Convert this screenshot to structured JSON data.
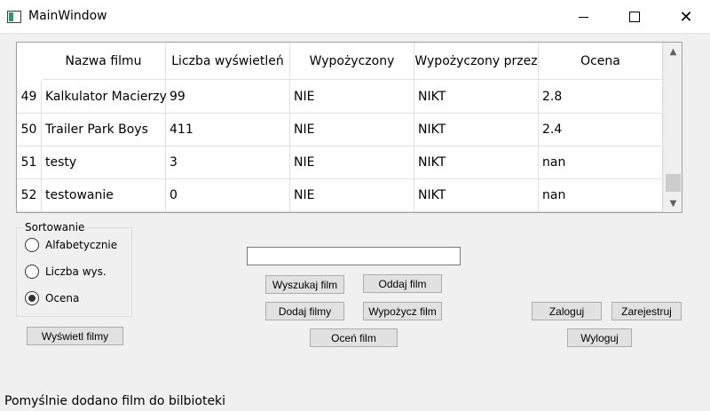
{
  "window": {
    "title": "MainWindow",
    "minimize": "",
    "maximize": "",
    "close": "✕"
  },
  "table": {
    "headers": [
      "Nazwa filmu",
      "Liczba wyświetleń",
      "Wypożyczony",
      "Wypożyczony przez",
      "Ocena"
    ],
    "rows": [
      {
        "num": "49",
        "cells": [
          "Kalkulator Macierzy",
          "99",
          "NIE",
          "NIKT",
          "2.8"
        ]
      },
      {
        "num": "50",
        "cells": [
          "Trailer Park Boys",
          "411",
          "NIE",
          "NIKT",
          "2.4"
        ]
      },
      {
        "num": "51",
        "cells": [
          "testy",
          "3",
          "NIE",
          "NIKT",
          "nan"
        ]
      },
      {
        "num": "52",
        "cells": [
          "testowanie",
          "0",
          "NIE",
          "NIKT",
          "nan"
        ]
      }
    ],
    "scroll_up": "▲",
    "scroll_down": "▼"
  },
  "sorting": {
    "title": "Sortowanie",
    "options": [
      {
        "label": "Alfabetycznie",
        "checked": false
      },
      {
        "label": "Liczba wys.",
        "checked": false
      },
      {
        "label": "Ocena",
        "checked": true
      }
    ]
  },
  "search": {
    "value": "",
    "placeholder": ""
  },
  "buttons": {
    "show_films": "Wyświetl filmy",
    "search_film": "Wyszukaj film",
    "return_film": "Oddaj film",
    "add_films": "Dodaj filmy",
    "rent_film": "Wypożycz film",
    "rate_film": "Oceń film",
    "login": "Zaloguj",
    "register": "Zarejestruj",
    "logout": "Wyloguj"
  },
  "status": "Pomyślnie dodano film do bilbioteki"
}
